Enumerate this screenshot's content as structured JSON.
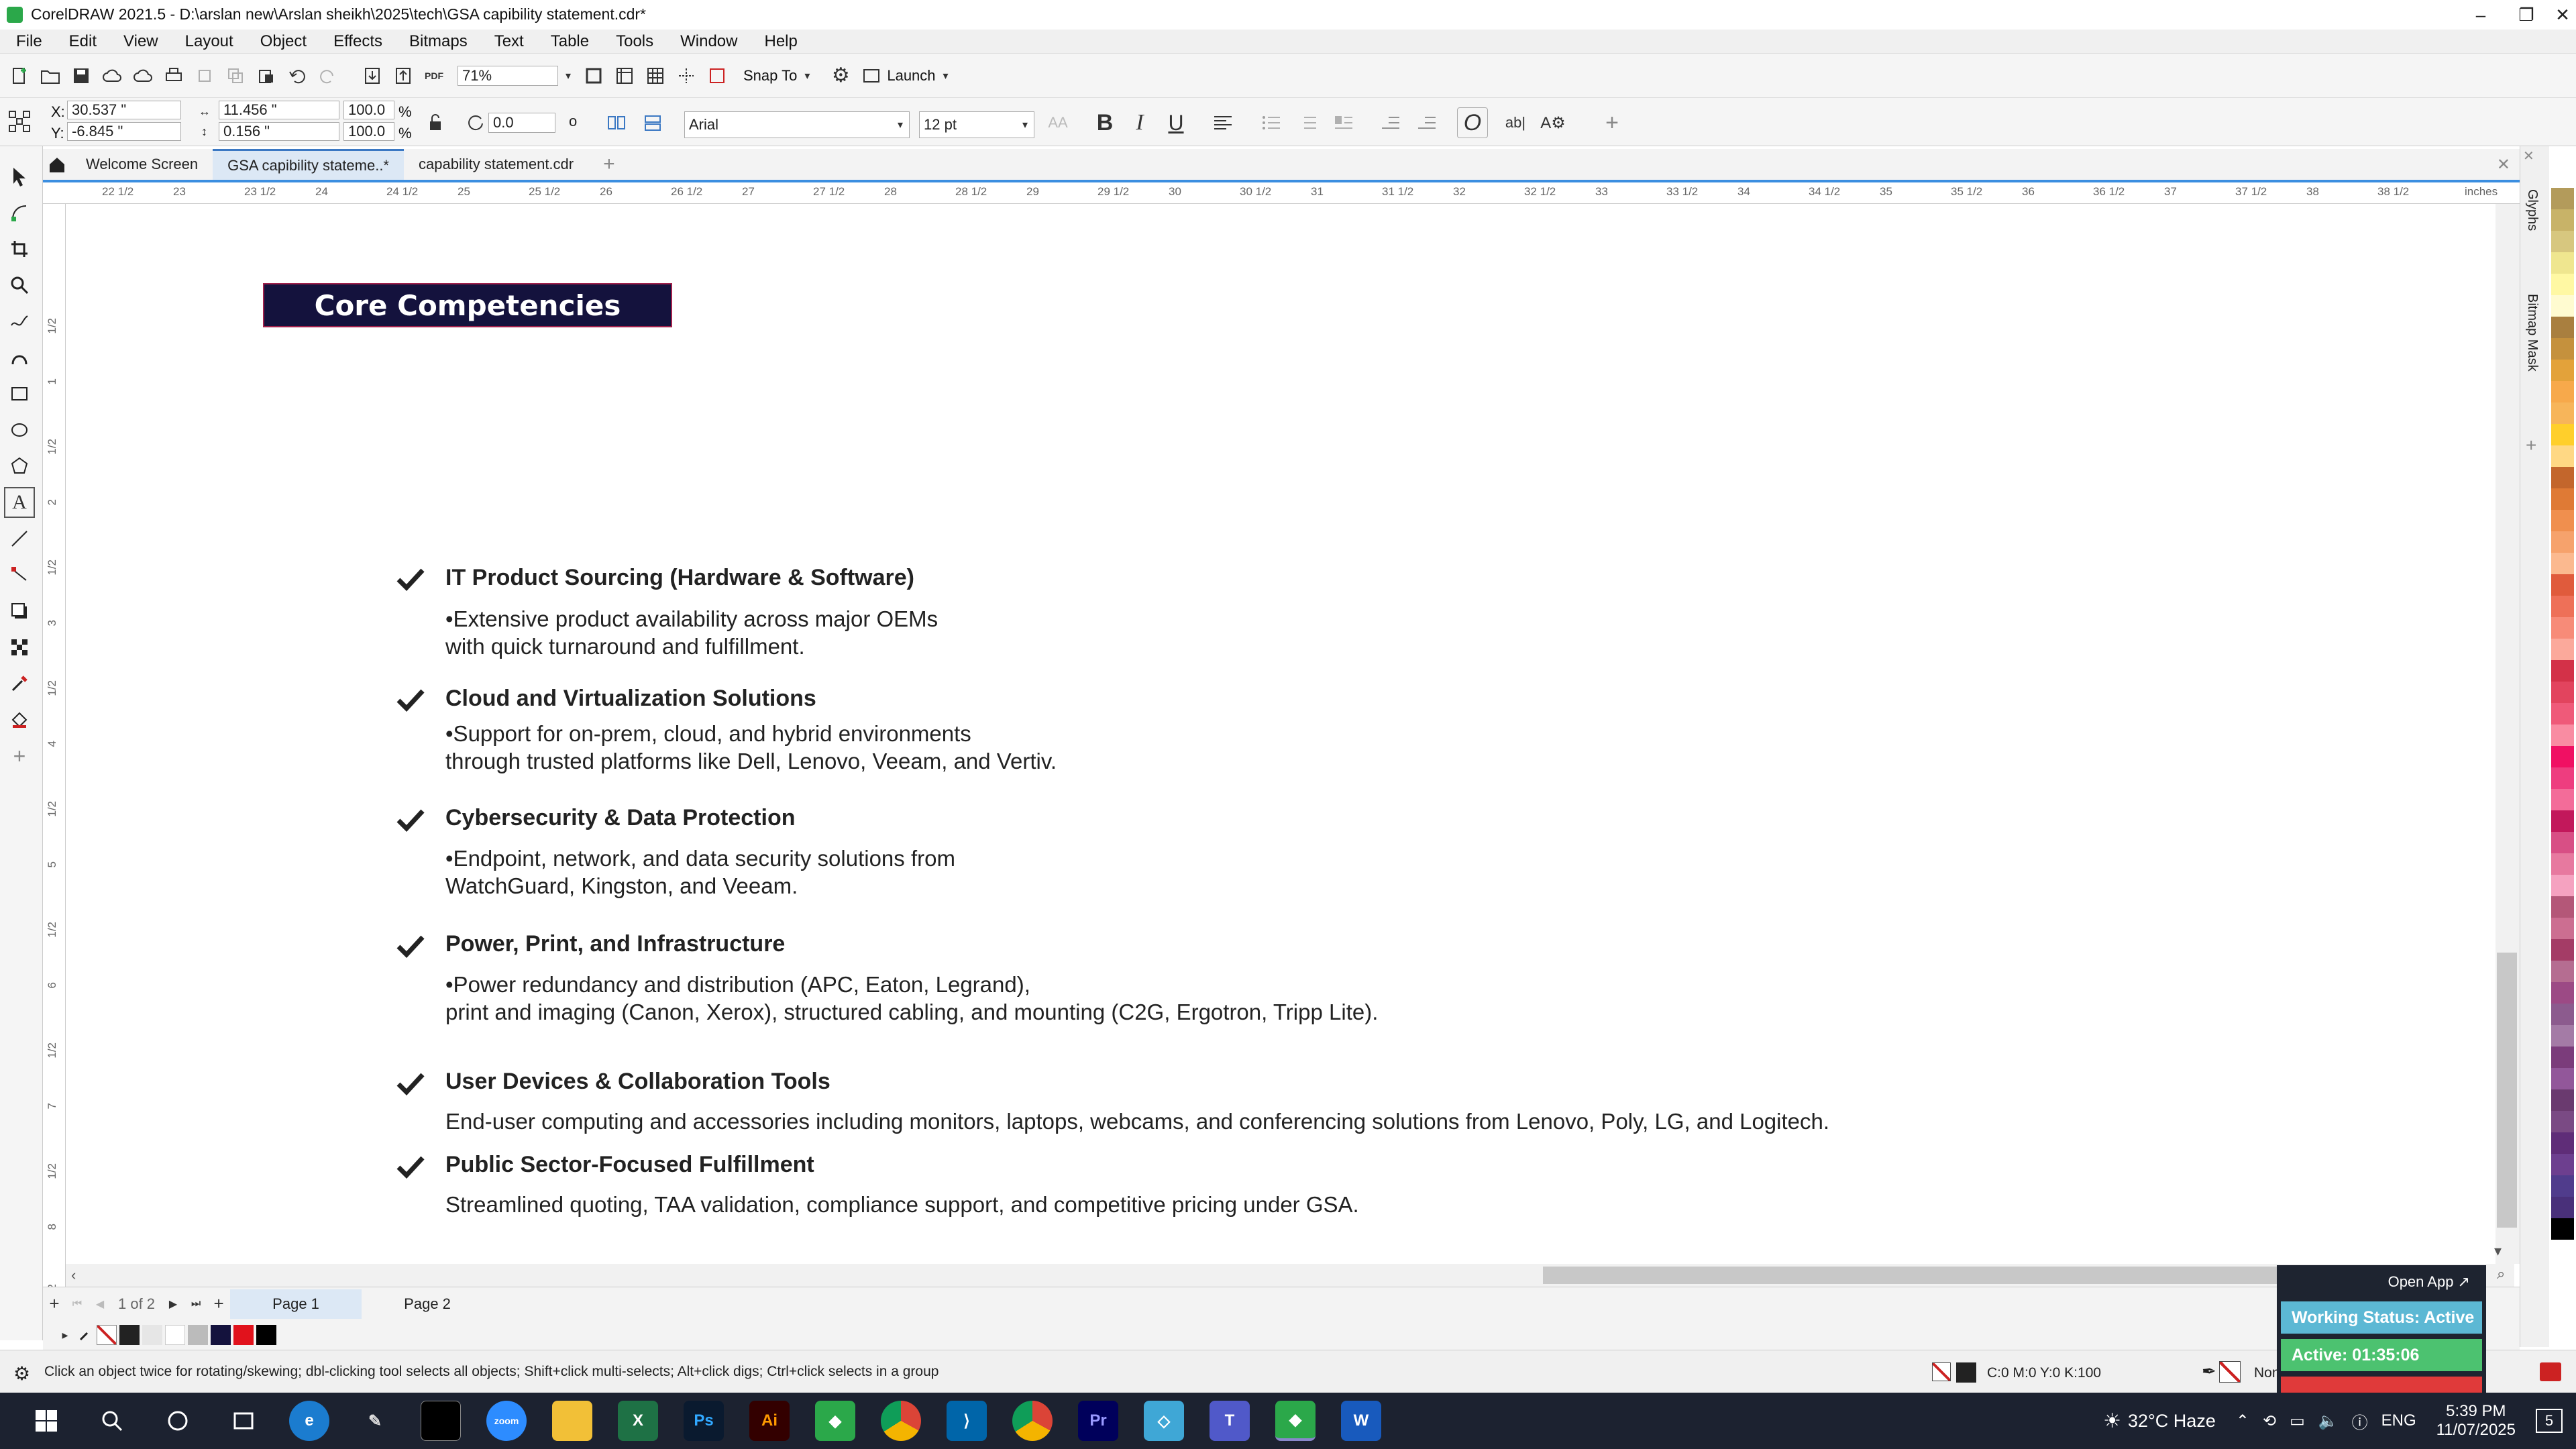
{
  "window": {
    "title": "CorelDRAW 2021.5 - D:\\arslan new\\Arslan sheikh\\2025\\tech\\GSA  capibility statement.cdr*"
  },
  "menu": [
    "File",
    "Edit",
    "View",
    "Layout",
    "Object",
    "Effects",
    "Bitmaps",
    "Text",
    "Table",
    "Tools",
    "Window",
    "Help"
  ],
  "toolbar": {
    "zoom": "71%",
    "snap_to": "Snap To",
    "launch": "Launch"
  },
  "property_bar": {
    "x": "30.537 \"",
    "y": "-6.845 \"",
    "width": "11.456 \"",
    "height": "0.156 \"",
    "scale_x": "100.0",
    "scale_y": "100.0",
    "percent": "%",
    "rotation": "0.0",
    "font": "Arial",
    "font_size": "12 pt"
  },
  "tabs": [
    {
      "label": "Welcome Screen"
    },
    {
      "label": "GSA   capibility stateme..*"
    },
    {
      "label": "capability statement.cdr"
    }
  ],
  "ruler": {
    "unit": "inches",
    "ticks": [
      "22 1/2",
      "23",
      "23 1/2",
      "24",
      "24 1/2",
      "25",
      "25 1/2",
      "26",
      "26 1/2",
      "27",
      "27 1/2",
      "28",
      "28 1/2",
      "29",
      "29 1/2",
      "30",
      "30 1/2",
      "31",
      "31 1/2",
      "32",
      "32 1/2",
      "33",
      "33 1/2",
      "34",
      "34 1/2",
      "35",
      "35 1/2",
      "36",
      "36 1/2",
      "37",
      "37 1/2",
      "38",
      "38 1/2"
    ],
    "vticks": [
      "1/2",
      "1",
      "1/2",
      "2",
      "1/2",
      "3",
      "1/2",
      "4",
      "1/2",
      "5",
      "1/2",
      "6",
      "1/2",
      "7",
      "1/2",
      "8",
      "1/2",
      "9"
    ]
  },
  "document": {
    "heading": "Core Competencies",
    "items": [
      {
        "title": "IT Product Sourcing (Hardware & Software)",
        "line1": "•Extensive product availability across major OEMs",
        "line2": "with quick turnaround and fulfillment."
      },
      {
        "title": "Cloud and Virtualization Solutions",
        "line1": "•Support for on-prem, cloud, and hybrid environments",
        "line2": "through trusted platforms like Dell, Lenovo, Veeam, and Vertiv."
      },
      {
        "title": "Cybersecurity & Data Protection",
        "line1": "•Endpoint, network, and data security solutions from",
        "line2": "WatchGuard, Kingston, and Veeam."
      },
      {
        "title": "Power, Print, and Infrastructure",
        "line1": "•Power redundancy and distribution (APC, Eaton, Legrand),",
        "line2": "print and imaging (Canon, Xerox), structured cabling, and mounting (C2G, Ergotron, Tripp Lite)."
      },
      {
        "title": "User Devices & Collaboration Tools",
        "line1": "End-user computing and accessories including monitors, laptops, webcams, and conferencing solutions from Lenovo, Poly, LG, and Logitech.",
        "line2": ""
      },
      {
        "title": "Public Sector-Focused Fulfillment",
        "line1": "Streamlined quoting, TAA validation, compliance support, and competitive pricing under GSA.",
        "line2": ""
      }
    ]
  },
  "pages": {
    "counter": "1 of 2",
    "tabs": [
      "Page 1",
      "Page 2"
    ]
  },
  "dockers": [
    "Glyphs",
    "Bitmap Mask"
  ],
  "status": {
    "hint": "Click an object twice for rotating/skewing; dbl-clicking tool selects all objects; Shift+click multi-selects; Alt+click digs; Ctrl+click selects in a group",
    "fill": "C:0 M:0 Y:0 K:100",
    "outline": "None"
  },
  "popup": {
    "open_app": "Open App ↗",
    "working_status": "Working Status: Active",
    "active_time": "Active: 01:35:06"
  },
  "taskbar": {
    "weather": "32°C  Haze",
    "lang": "ENG",
    "time": "5:39 PM",
    "date": "11/07/2025",
    "notifications": "5"
  },
  "colors": {
    "heading_bg": "#14123d",
    "heading_border": "#a0204b",
    "accent": "#3b78c3"
  }
}
